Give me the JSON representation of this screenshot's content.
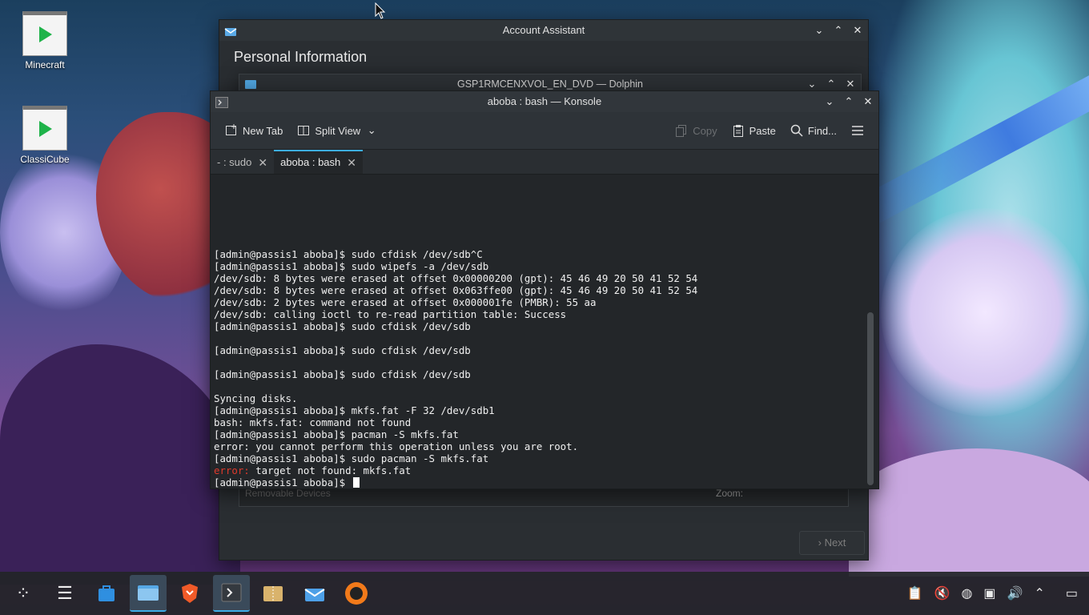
{
  "desktop": {
    "icons": [
      {
        "label": "Minecraft"
      },
      {
        "label": "ClassiCube"
      }
    ]
  },
  "account_assistant": {
    "title": "Account Assistant",
    "heading": "Personal Information",
    "removable_devices": "Removable Devices",
    "zoom_label": "Zoom:",
    "next_button": "Next"
  },
  "dolphin": {
    "title": "GSP1RMCENXVOL_EN_DVD — Dolphin"
  },
  "konsole": {
    "title": "aboba : bash — Konsole",
    "toolbar": {
      "new_tab": "New Tab",
      "split_view": "Split View",
      "copy": "Copy",
      "paste": "Paste",
      "find": "Find..."
    },
    "tabs": [
      {
        "label": "- : sudo"
      },
      {
        "label": "aboba : bash"
      }
    ],
    "terminal_lines": [
      "[admin@passis1 aboba]$ sudo cfdisk /dev/sdb^C",
      "[admin@passis1 aboba]$ sudo wipefs -a /dev/sdb",
      "/dev/sdb: 8 bytes were erased at offset 0x00000200 (gpt): 45 46 49 20 50 41 52 54",
      "/dev/sdb: 8 bytes were erased at offset 0x063ffe00 (gpt): 45 46 49 20 50 41 52 54",
      "/dev/sdb: 2 bytes were erased at offset 0x000001fe (PMBR): 55 aa",
      "/dev/sdb: calling ioctl to re-read partition table: Success",
      "[admin@passis1 aboba]$ sudo cfdisk /dev/sdb",
      "",
      "[admin@passis1 aboba]$ sudo cfdisk /dev/sdb",
      "",
      "[admin@passis1 aboba]$ sudo cfdisk /dev/sdb",
      "",
      "Syncing disks.",
      "[admin@passis1 aboba]$ mkfs.fat -F 32 /dev/sdb1",
      "bash: mkfs.fat: command not found",
      "[admin@passis1 aboba]$ pacman -S mkfs.fat",
      "error: you cannot perform this operation unless you are root.",
      "[admin@passis1 aboba]$ sudo pacman -S mkfs.fat"
    ],
    "error_prefix": "error:",
    "error_rest": " target not found: mkfs.fat",
    "prompt": "[admin@passis1 aboba]$ "
  },
  "colors": {
    "accent": "#3daee9",
    "error": "#e0392b",
    "terminal_bg": "#232629"
  },
  "taskbar": {
    "items": [
      "app-launcher-icon",
      "virtual-desktops-icon",
      "discover-store-icon",
      "dolphin-files-icon",
      "brave-browser-icon",
      "konsole-icon",
      "archive-icon",
      "thunderbird-icon",
      "obs-icon"
    ],
    "tray": [
      "clipboard-icon",
      "muted-speaker-icon",
      "network-icon",
      "display-icon",
      "volume-icon",
      "expand-tray-icon",
      "show-desktop-icon"
    ]
  }
}
